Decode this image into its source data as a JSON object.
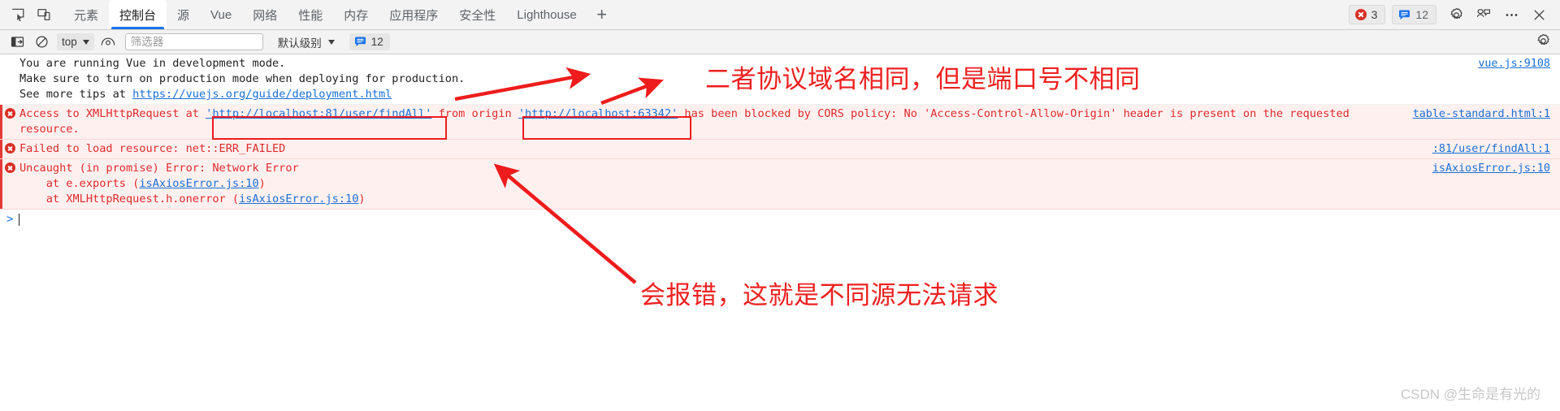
{
  "window": {
    "tabs": [
      {
        "label": "元素",
        "active": false
      },
      {
        "label": "控制台",
        "active": true
      },
      {
        "label": "源",
        "active": false
      },
      {
        "label": "Vue",
        "active": false
      },
      {
        "label": "网络",
        "active": false
      },
      {
        "label": "性能",
        "active": false
      },
      {
        "label": "内存",
        "active": false
      },
      {
        "label": "应用程序",
        "active": false
      },
      {
        "label": "安全性",
        "active": false
      },
      {
        "label": "Lighthouse",
        "active": false
      }
    ],
    "add_tab_label": "+",
    "error_count": "3",
    "message_count": "12",
    "accent_blue": "#1a73e8",
    "error_red": "#d93025"
  },
  "toolbar": {
    "context_label": "top",
    "filter_placeholder": "筛选器",
    "filter_value": "",
    "level_label": "默认级别",
    "message_badge": "12"
  },
  "console": {
    "rows": [
      {
        "type": "info",
        "lines": [
          "You are running Vue in development mode.",
          "Make sure to turn on production mode when deploying for production.",
          "See more tips at "
        ],
        "link_text": "https://vuejs.org/guide/deployment.html",
        "source": "vue.js:9108"
      },
      {
        "type": "error",
        "prefix": "Access to XMLHttpRequest at ",
        "url1": "'http://localhost:81/user/findAll'",
        "middle": " from origin ",
        "url2": "'http://localhost:63342'",
        "suffix": " has been blocked by CORS policy: No 'Access-Control-Allow-Origin' header is present on the requested resource.",
        "source": "table-standard.html:1"
      },
      {
        "type": "error",
        "text": "Failed to load resource: net::ERR_FAILED",
        "source": ":81/user/findAll:1"
      },
      {
        "type": "error",
        "text": "Uncaught (in promise) Error: Network Error",
        "stack": [
          {
            "pre": "    at e.exports (",
            "link": "isAxiosError.js:10",
            "post": ")"
          },
          {
            "pre": "    at XMLHttpRequest.h.onerror (",
            "link": "isAxiosError.js:10",
            "post": ")"
          }
        ],
        "source": "isAxiosError.js:10"
      }
    ],
    "prompt_symbol": ">"
  },
  "annotations": {
    "note_top": "二者协议域名相同，但是端口号不相同",
    "note_bottom": "会报错，这就是不同源无法请求",
    "highlight_color": "#ee1c1c"
  },
  "watermark": "CSDN @生命是有光的"
}
